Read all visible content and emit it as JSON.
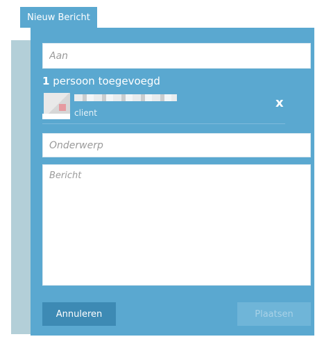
{
  "tab": {
    "label": "Nieuw Bericht"
  },
  "form": {
    "to_placeholder": "Aan",
    "count_number": "1",
    "count_text": "persoon toegevoegd",
    "recipient_role": "client",
    "remove_label": "x",
    "subject_placeholder": "Onderwerp",
    "message_placeholder": "Bericht"
  },
  "buttons": {
    "cancel": "Annuleren",
    "post": "Plaatsen"
  },
  "colors": {
    "panel": "#5aa8d0",
    "backdrop": "#b3cfd8",
    "cancel": "#3d8ab4",
    "post_disabled": "#6fb5d8"
  }
}
